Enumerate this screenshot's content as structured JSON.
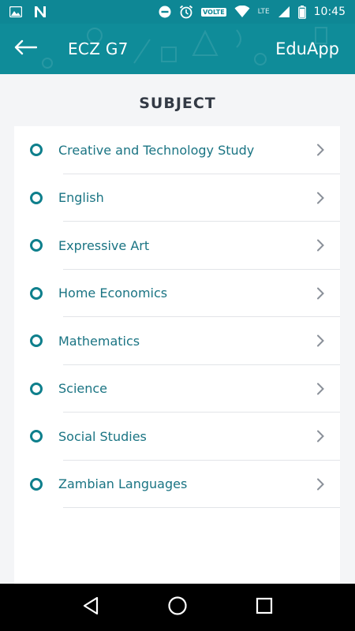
{
  "status_bar": {
    "time": "10:45",
    "network_label": "LTE",
    "volte_label": "VOLTE",
    "icons": [
      "image-icon",
      "n-logo-icon",
      "dnd-icon",
      "alarm-icon",
      "wifi-icon",
      "signal-icon",
      "battery-icon"
    ]
  },
  "app_bar": {
    "title": "ECZ G7",
    "app_name": "EduApp",
    "back_icon": "arrow-left-icon"
  },
  "section_title": "SUBJECT",
  "subjects": [
    {
      "label": "Creative and Technology Study"
    },
    {
      "label": "English"
    },
    {
      "label": "Expressive Art"
    },
    {
      "label": "Home Economics"
    },
    {
      "label": "Mathematics"
    },
    {
      "label": "Science"
    },
    {
      "label": "Social Studies"
    },
    {
      "label": "Zambian Languages"
    }
  ],
  "nav_bar": {
    "icons": [
      "back-triangle-icon",
      "home-circle-icon",
      "recents-square-icon"
    ]
  },
  "colors": {
    "primary": "#0f8c99",
    "accent_text": "#1a7483",
    "background": "#f4f5f7"
  }
}
